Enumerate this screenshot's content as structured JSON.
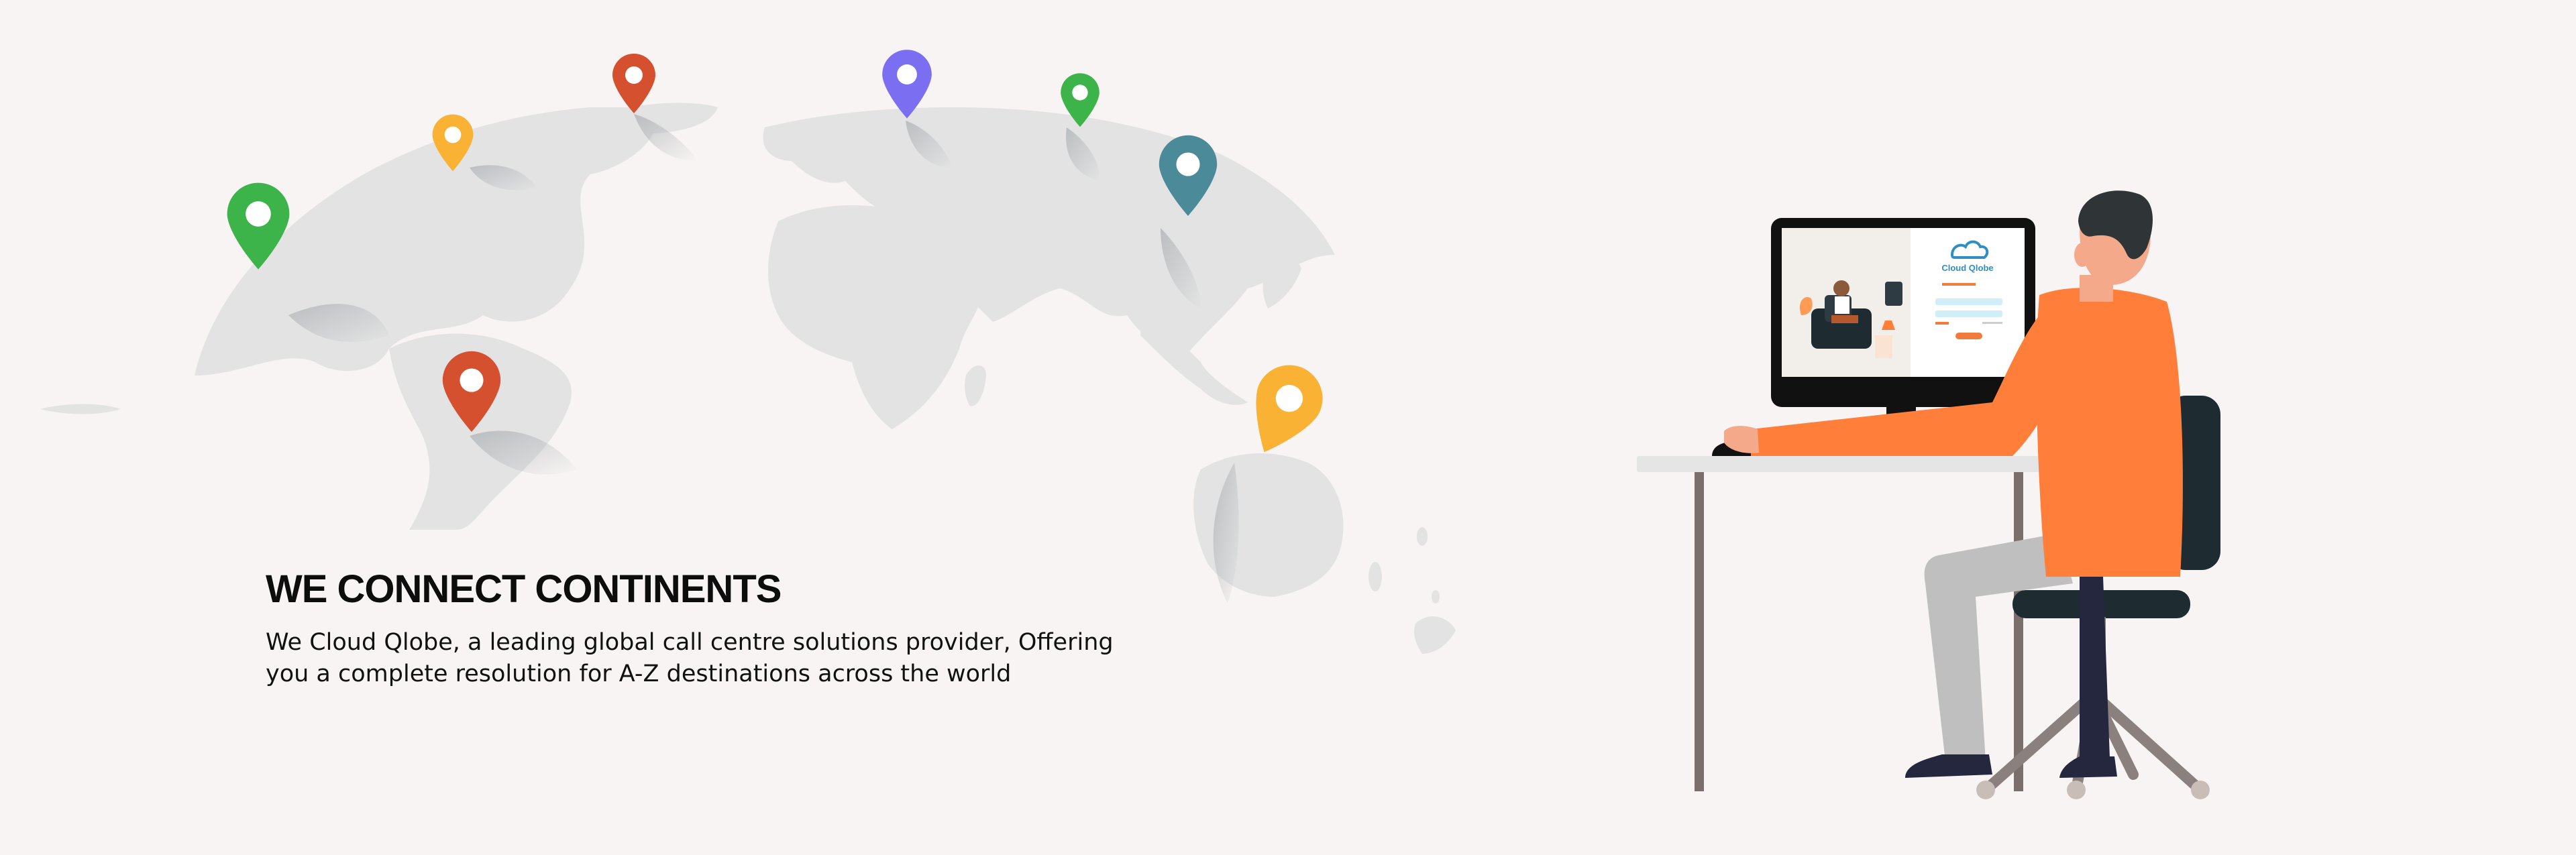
{
  "hero": {
    "title": "WE CONNECT CONTINENTS",
    "description_lines": [
      "We Cloud Qlobe, a leading global call centre solutions provider, Offering",
      "you a complete resolution for A-Z destinations across the world"
    ]
  },
  "map": {
    "pin_colors": [
      "#3cb44a",
      "#f9b233",
      "#d4502f",
      "#7b6ef0",
      "#3cb44a",
      "#4b8a99",
      "#f9b233",
      "#d4502f"
    ],
    "land_color": "#e3e3e3"
  },
  "illustration": {
    "screen_brand": "Cloud Qlobe",
    "shirt_color": "#ff7f3a",
    "chair_color": "#1e2b31",
    "desk_color": "#e5e5e5"
  }
}
